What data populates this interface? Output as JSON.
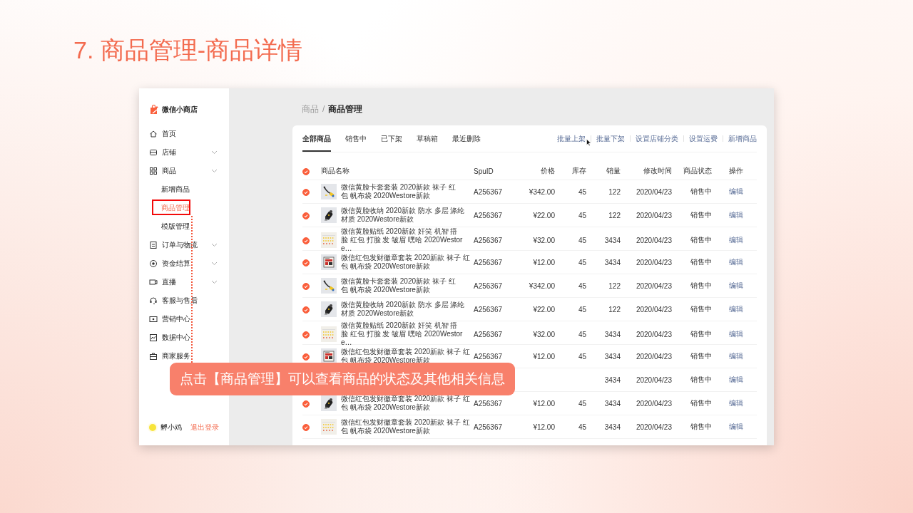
{
  "slide_title": "7. 商品管理-商品详情",
  "sidebar": {
    "shop_name": "微信小商店",
    "items": [
      {
        "label": "首页",
        "expandable": false
      },
      {
        "label": "店铺",
        "expandable": true
      },
      {
        "label": "商品",
        "expandable": true,
        "children": [
          {
            "label": "新增商品",
            "selected": false,
            "highlighted": false
          },
          {
            "label": "商品管理",
            "selected": true,
            "highlighted": true
          },
          {
            "label": "模版管理",
            "selected": false,
            "highlighted": false
          }
        ]
      },
      {
        "label": "订单与物流",
        "expandable": true
      },
      {
        "label": "资金结算",
        "expandable": true
      },
      {
        "label": "直播",
        "expandable": true
      },
      {
        "label": "客服与售后",
        "expandable": false
      },
      {
        "label": "营销中心",
        "expandable": false
      },
      {
        "label": "数据中心",
        "expandable": false
      },
      {
        "label": "商家服务",
        "expandable": false
      }
    ],
    "user": {
      "name": "孵小鸡",
      "logout": "退出登录"
    }
  },
  "breadcrumb": {
    "parent": "商品",
    "separator": "/",
    "current": "商品管理"
  },
  "tabs": [
    {
      "label": "全部商品",
      "selected": true
    },
    {
      "label": "销售中",
      "selected": false
    },
    {
      "label": "已下架",
      "selected": false
    },
    {
      "label": "草稿箱",
      "selected": false
    },
    {
      "label": "最近删除",
      "selected": false
    }
  ],
  "actions": [
    "批量上架",
    "批量下架",
    "设置店铺分类",
    "设置运费",
    "新增商品"
  ],
  "table": {
    "header_checked": true,
    "columns": [
      "商品名称",
      "SpuID",
      "价格",
      "库存",
      "销量",
      "修改时间",
      "商品状态",
      "操作"
    ],
    "rows": [
      {
        "checked": true,
        "name": "微信黄脸卡套套装 2020新款 袜子 红包 帆布袋 2020Westore新款",
        "spu_id": "A256367",
        "price": "¥342.00",
        "stock": "45",
        "sales": "122",
        "modified": "2020/04/23",
        "status": "销售中",
        "action": "编辑"
      },
      {
        "checked": true,
        "name": "微信黄脸收纳 2020新款 防水 多层 涤纶材质 2020Westore新款",
        "spu_id": "A256367",
        "price": "¥22.00",
        "stock": "45",
        "sales": "122",
        "modified": "2020/04/23",
        "status": "销售中",
        "action": "编辑"
      },
      {
        "checked": true,
        "name": "微信黄脸贴纸 2020新款 奸笑 机智 捂脸 红包 打脸 发 皱眉 嘿哈 2020Westore…",
        "spu_id": "A256367",
        "price": "¥32.00",
        "stock": "45",
        "sales": "3434",
        "modified": "2020/04/23",
        "status": "销售中",
        "action": "编辑"
      },
      {
        "checked": true,
        "name": "微信红包发财徽章套装 2020新款 袜子 红包 帆布袋 2020Westore新款",
        "spu_id": "A256367",
        "price": "¥12.00",
        "stock": "45",
        "sales": "3434",
        "modified": "2020/04/23",
        "status": "销售中",
        "action": "编辑"
      },
      {
        "checked": true,
        "name": "微信黄脸卡套套装 2020新款 袜子 红包 帆布袋 2020Westore新款",
        "spu_id": "A256367",
        "price": "¥342.00",
        "stock": "45",
        "sales": "122",
        "modified": "2020/04/23",
        "status": "销售中",
        "action": "编辑"
      },
      {
        "checked": true,
        "name": "微信黄脸收纳 2020新款 防水 多层 涤纶材质 2020Westore新款",
        "spu_id": "A256367",
        "price": "¥22.00",
        "stock": "45",
        "sales": "122",
        "modified": "2020/04/23",
        "status": "销售中",
        "action": "编辑"
      },
      {
        "checked": true,
        "name": "微信黄脸贴纸 2020新款 奸笑 机智 捂脸 红包 打脸 发 皱眉 嘿哈 2020Westore…",
        "spu_id": "A256367",
        "price": "¥32.00",
        "stock": "45",
        "sales": "3434",
        "modified": "2020/04/23",
        "status": "销售中",
        "action": "编辑"
      },
      {
        "checked": true,
        "name": "微信红包发财徽章套装 2020新款 袜子 红包 帆布袋 2020Westore新款",
        "spu_id": "A256367",
        "price": "¥12.00",
        "stock": "45",
        "sales": "3434",
        "modified": "2020/04/23",
        "status": "销售中",
        "action": "编辑"
      },
      {
        "sales": "3434",
        "modified": "2020/04/23",
        "status": "销售中",
        "action": "编辑"
      },
      {
        "checked": true,
        "name": "微信红包发财徽章套装 2020新款 袜子 红包 帆布袋 2020Westore新款",
        "spu_id": "A256367",
        "price": "¥12.00",
        "stock": "45",
        "sales": "3434",
        "modified": "2020/04/23",
        "status": "销售中",
        "action": "编辑"
      },
      {
        "checked": true,
        "name": "微信红包发财徽章套装 2020新款 袜子 红包 帆布袋 2020Westore新款",
        "spu_id": "A256367",
        "price": "¥12.00",
        "stock": "45",
        "sales": "3434",
        "modified": "2020/04/23",
        "status": "销售中",
        "action": "编辑"
      }
    ]
  },
  "callout": "点击【商品管理】可以查看商品的状态及其他相关信息"
}
